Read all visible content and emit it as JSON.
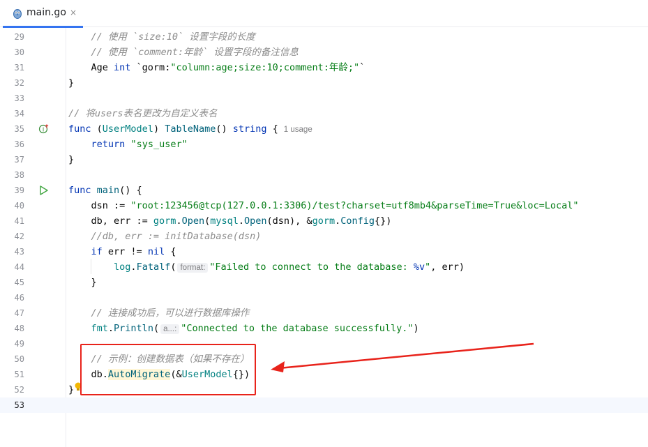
{
  "tab": {
    "filename": "main.go",
    "close_glyph": "×",
    "icon": "gopher-icon"
  },
  "lines": [
    {
      "n": "29",
      "segs": [
        [
          "    ",
          ""
        ],
        [
          "// 使用 `size:10` 设置字段的长度",
          "cm"
        ]
      ]
    },
    {
      "n": "30",
      "segs": [
        [
          "    ",
          ""
        ],
        [
          "// 使用 `comment:年龄` 设置字段的备注信息",
          "cm"
        ]
      ]
    },
    {
      "n": "31",
      "segs": [
        [
          "    Age ",
          ""
        ],
        [
          "int",
          "kw"
        ],
        [
          " `gorm:",
          ""
        ],
        [
          "\"column:age;size:10;comment:年龄;\"",
          "str"
        ],
        [
          "`",
          ""
        ]
      ]
    },
    {
      "n": "32",
      "segs": [
        [
          "}",
          ""
        ]
      ]
    },
    {
      "n": "33",
      "segs": []
    },
    {
      "n": "34",
      "segs": [
        [
          "// 将users表名更改为自定义表名",
          "cm"
        ]
      ]
    },
    {
      "n": "35",
      "segs": [
        [
          "func",
          "kw"
        ],
        [
          " (",
          ""
        ],
        [
          "UserModel",
          "typ"
        ],
        [
          ") ",
          ""
        ],
        [
          "TableName",
          "fn"
        ],
        [
          "() ",
          ""
        ],
        [
          "string",
          "kw"
        ],
        [
          " {",
          ""
        ],
        [
          "1 usage",
          "usage"
        ]
      ]
    },
    {
      "n": "36",
      "segs": [
        [
          "    ",
          ""
        ],
        [
          "return",
          "kw"
        ],
        [
          " ",
          ""
        ],
        [
          "\"sys_user\"",
          "str"
        ]
      ]
    },
    {
      "n": "37",
      "segs": [
        [
          "}",
          ""
        ]
      ]
    },
    {
      "n": "38",
      "segs": []
    },
    {
      "n": "39",
      "segs": [
        [
          "func",
          "kw"
        ],
        [
          " ",
          ""
        ],
        [
          "main",
          "fn"
        ],
        [
          "() {",
          ""
        ]
      ]
    },
    {
      "n": "40",
      "segs": [
        [
          "    dsn := ",
          ""
        ],
        [
          "\"root:123456@tcp(127.0.0.1:3306)/test?charset=utf8mb4&parseTime=True&loc=Local\"",
          "str"
        ]
      ]
    },
    {
      "n": "41",
      "segs": [
        [
          "    db, err := ",
          ""
        ],
        [
          "gorm",
          "typ"
        ],
        [
          ".",
          ""
        ],
        [
          "Open",
          "fn"
        ],
        [
          "(",
          ""
        ],
        [
          "mysql",
          "typ"
        ],
        [
          ".",
          ""
        ],
        [
          "Open",
          "fn"
        ],
        [
          "(dsn), &",
          ""
        ],
        [
          "gorm",
          "typ"
        ],
        [
          ".",
          ""
        ],
        [
          "Config",
          "fn"
        ],
        [
          "{})",
          ""
        ]
      ]
    },
    {
      "n": "42",
      "segs": [
        [
          "    ",
          ""
        ],
        [
          "//db, err := initDatabase(dsn)",
          "cm"
        ]
      ]
    },
    {
      "n": "43",
      "segs": [
        [
          "    ",
          ""
        ],
        [
          "if",
          "kw"
        ],
        [
          " err != ",
          ""
        ],
        [
          "nil",
          "kw"
        ],
        [
          " {",
          ""
        ]
      ]
    },
    {
      "n": "44",
      "segs": [
        [
          "        ",
          ""
        ],
        [
          "log",
          "typ"
        ],
        [
          ".",
          ""
        ],
        [
          "Fatalf",
          "fn"
        ],
        [
          "(",
          ""
        ],
        [
          "format:",
          "hint"
        ],
        [
          "\"Failed to connect to the database: ",
          "str"
        ],
        [
          "%v",
          "kw"
        ],
        [
          "\"",
          "str"
        ],
        [
          ", err)",
          ""
        ]
      ]
    },
    {
      "n": "45",
      "segs": [
        [
          "    }",
          ""
        ]
      ]
    },
    {
      "n": "46",
      "segs": []
    },
    {
      "n": "47",
      "segs": [
        [
          "    ",
          ""
        ],
        [
          "// 连接成功后，可以进行数据库操作",
          "cm"
        ]
      ]
    },
    {
      "n": "48",
      "segs": [
        [
          "    ",
          ""
        ],
        [
          "fmt",
          "typ"
        ],
        [
          ".",
          ""
        ],
        [
          "Println",
          "fn"
        ],
        [
          "(",
          ""
        ],
        [
          "a...:",
          "hint"
        ],
        [
          "\"Connected to the database successfully.\"",
          "str"
        ],
        [
          ")",
          ""
        ]
      ]
    },
    {
      "n": "49",
      "segs": []
    },
    {
      "n": "50",
      "segs": [
        [
          "    ",
          ""
        ],
        [
          "// 示例：创建数据表（如果不存在）",
          "cm"
        ]
      ]
    },
    {
      "n": "51",
      "segs": [
        [
          "    db.",
          ""
        ],
        [
          "AutoMigrate",
          "automig"
        ],
        [
          "(&",
          ""
        ],
        [
          "UserModel",
          "typ"
        ],
        [
          "{})",
          ""
        ]
      ]
    },
    {
      "n": "52",
      "segs": [
        [
          "}",
          ""
        ]
      ]
    },
    {
      "n": "53",
      "segs": []
    }
  ],
  "current_line": "53",
  "gutter_icons": {
    "35": "implementation-icon",
    "39": "run-icon"
  },
  "colors": {
    "annotation": "#e8231b",
    "tab_accent": "#3574f0"
  }
}
